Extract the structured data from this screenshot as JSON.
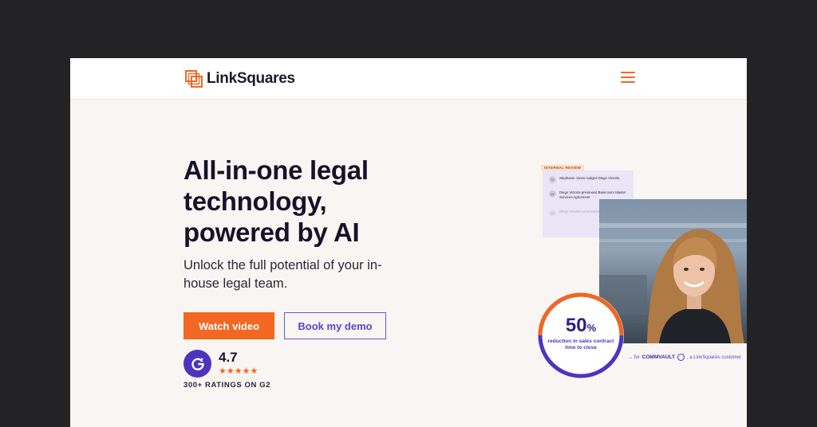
{
  "nav": {
    "logo_text": "LinkSquares",
    "menu_icon": "hamburger-icon"
  },
  "hero": {
    "title": "All-in-one legal technology, powered by AI",
    "subtitle": "Unlock the full potential of your in-house legal team.",
    "primary_button": "Watch video",
    "secondary_button": "Book my demo"
  },
  "rating": {
    "badge_icon": "g2-logo-icon",
    "score": "4.7",
    "stars": "★★★★★",
    "caption": "300+ RATINGS ON G2"
  },
  "review_card": {
    "tag": "INTERNAL REVIEW",
    "rows": [
      {
        "initials": "SJ",
        "text": "Stephanie Jones nudged Diego Victoria"
      },
      {
        "initials": "DV",
        "text": "Diego Victoria previewed Basecoom Master Services Agreement"
      },
      {
        "initials": "DV",
        "text": "Diego Victoria commented"
      }
    ]
  },
  "stat": {
    "number": "50",
    "unit": "%",
    "label": "reduction in sales contract time to close",
    "customer_prefix": "→ for",
    "customer_brand": "COMMVAULT",
    "customer_suffix": ", a LinkSquares customer"
  },
  "colors": {
    "accent_orange": "#f26722",
    "accent_purple": "#4b35c0",
    "page_bg": "#f8f5f2",
    "outer_bg": "#232326"
  }
}
